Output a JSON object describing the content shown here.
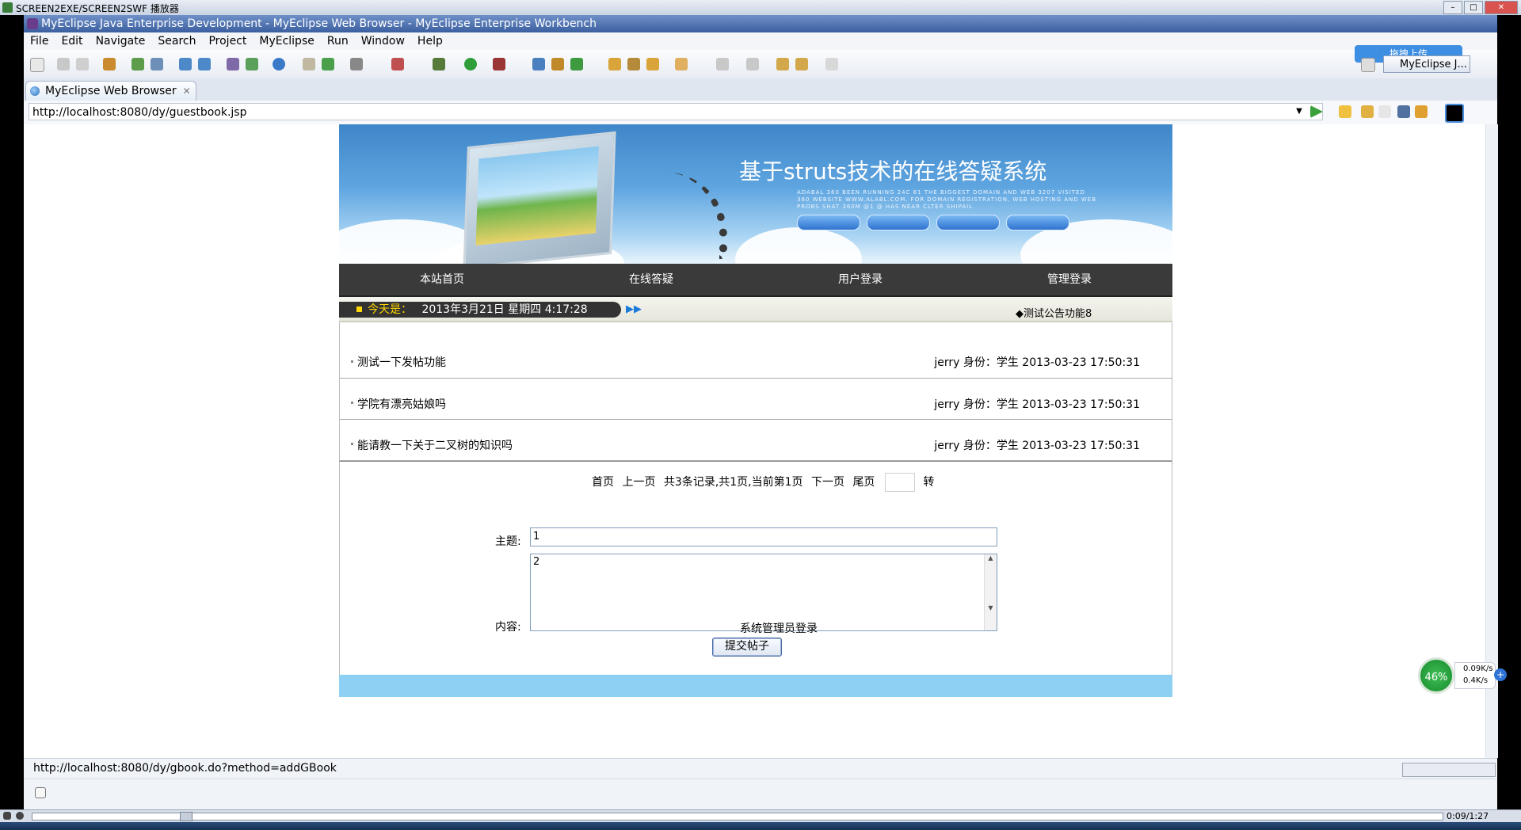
{
  "player": {
    "title": "SCREEN2EXE/SCREEN2SWF 播放器",
    "time": "0:09/1:27"
  },
  "window": {
    "title": "MyEclipse Java Enterprise Development - MyEclipse Web Browser - MyEclipse Enterprise Workbench",
    "upload_label": "拖拽上传"
  },
  "menu": [
    "File",
    "Edit",
    "Navigate",
    "Search",
    "Project",
    "MyEclipse",
    "Run",
    "Window",
    "Help"
  ],
  "perspective": "MyEclipse J...",
  "tab": {
    "label": "MyEclipse Web Browser",
    "close": "✕"
  },
  "browser": {
    "url": "http://localhost:8080/dy/guestbook.jsp",
    "status_url": "http://localhost:8080/dy/gbook.do?method=addGBook"
  },
  "site": {
    "banner_title": "基于struts技术的在线答疑系统",
    "banner_sub": "ADABAL 360 BEEN RUNNING 24C 81 THE BIGGEST DOMAIN AND WEB 3207 VISITED 360 WEBSITE WWW.ALABL.COM. FOR DOMAIN REGISTRATION, WEB HOSTING AND WEB PROBS SHAT 360M @1 @ HAS NEAR CLTER SHIPAIL",
    "nav": [
      "本站首页",
      "在线答疑",
      "用户登录",
      "管理登录"
    ],
    "date_label": "今天是：",
    "date_value": "2013年3月21日 星期四 4:17:28",
    "notice": "◆测试公告功能8",
    "posts": [
      {
        "subject": "测试一下发帖功能",
        "meta": "jerry 身份：学生 2013-03-23 17:50:31"
      },
      {
        "subject": "学院有漂亮姑娘吗",
        "meta": "jerry 身份：学生 2013-03-23 17:50:31"
      },
      {
        "subject": "能请教一下关于二叉树的知识吗",
        "meta": "jerry 身份：学生 2013-03-23 17:50:31"
      }
    ],
    "pager": {
      "first": "首页",
      "prev": "上一页",
      "info": "共3条记录,共1页,当前第1页",
      "next": "下一页",
      "last": "尾页",
      "go": "转"
    },
    "form": {
      "subject_label": "主题:",
      "subject_value": "1",
      "content_label": "内容:",
      "content_value": "2",
      "submit": "提交帖子"
    },
    "admin_link": "系统管理员登录"
  },
  "net_widget": {
    "percent": "46%",
    "up": "0.09K/s",
    "down": "0.4K/s"
  }
}
